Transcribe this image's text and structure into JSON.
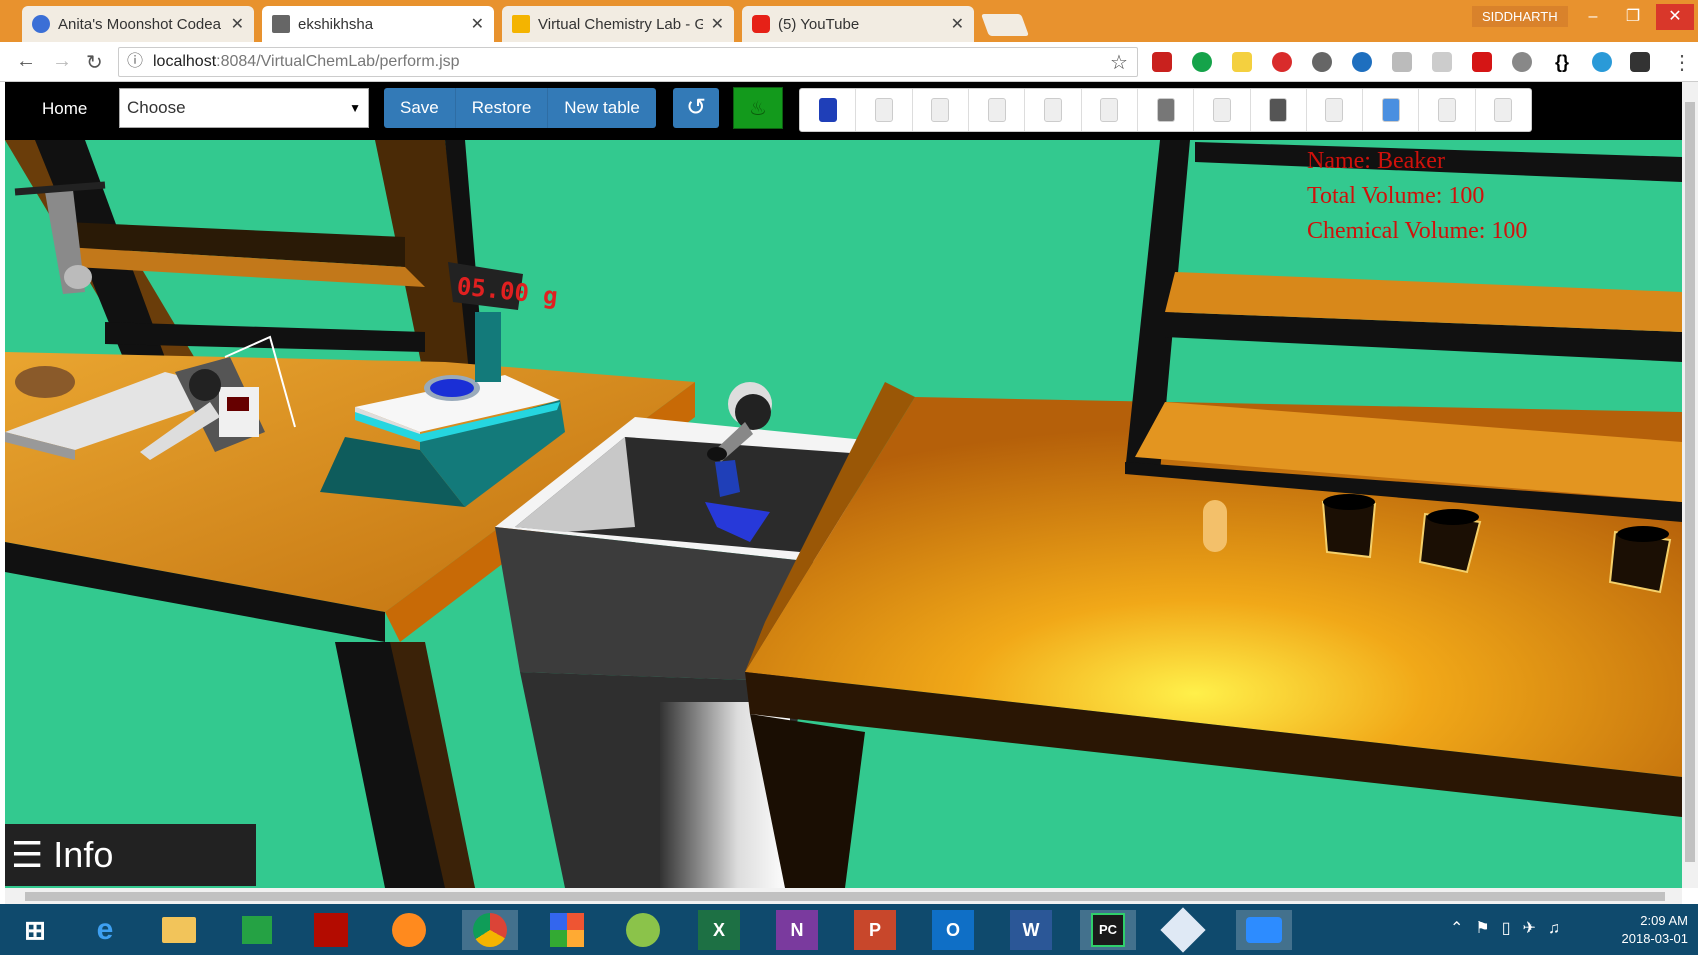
{
  "browser": {
    "tabs": [
      {
        "title": "Anita's Moonshot Codea",
        "icon": "rocket-icon",
        "active": false
      },
      {
        "title": "ekshikhsha",
        "icon": "page-icon",
        "active": true
      },
      {
        "title": "Virtual Chemistry Lab - G",
        "icon": "slides-icon",
        "active": false
      },
      {
        "title": "(5) YouTube",
        "icon": "youtube-icon",
        "active": false
      }
    ],
    "profile": "SIDDHARTH",
    "url_host": "localhost",
    "url_rest": ":8084/VirtualChemLab/perform.jsp"
  },
  "toolbar": {
    "home": "Home",
    "choose": "Choose",
    "buttons": {
      "save": "Save",
      "restore": "Restore",
      "new_table": "New table"
    },
    "apparatus": [
      "conical-flask",
      "glass-plate",
      "funnel",
      "test-tube-pair",
      "burette-stand",
      "measuring-cylinder",
      "crucible",
      "pipette",
      "watch-glass",
      "petri-dish",
      "tilted-beaker",
      "filter-funnel",
      "test-tube-rack"
    ]
  },
  "scene": {
    "display_reading": "05.00 g",
    "info": {
      "name": "Name: Beaker",
      "total": "Total Volume: 100",
      "chemical": "Chemical Volume: 100"
    },
    "info_button": "Info"
  },
  "taskbar": {
    "time": "2:09 AM",
    "date": "2018-03-01",
    "apps": [
      "windows-start",
      "internet-explorer",
      "file-explorer",
      "store",
      "acrobat",
      "firefox",
      "chrome",
      "ms-office",
      "android-studio",
      "excel",
      "onenote",
      "powerpoint",
      "outlook",
      "word",
      "pycharm",
      "virtualbox",
      "zoom"
    ]
  },
  "colors": {
    "floor": "#33c98f",
    "table": "#e8900f",
    "info_text": "#d0110b",
    "button_blue": "#337ab7"
  }
}
